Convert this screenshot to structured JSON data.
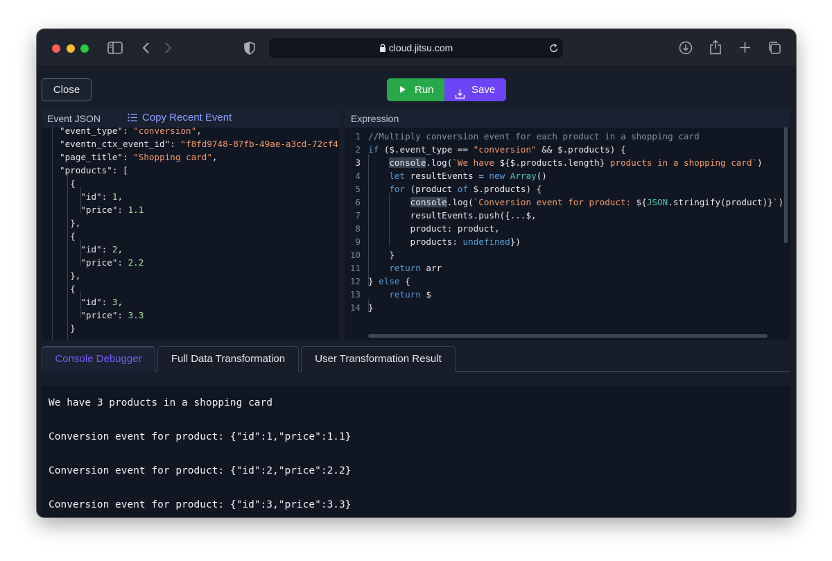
{
  "browser": {
    "url": "cloud.jitsu.com"
  },
  "actions": {
    "close_label": "Close",
    "run_label": "Run",
    "save_label": "Save"
  },
  "event_panel": {
    "title": "Event JSON",
    "copy_label": "Copy Recent Event",
    "lines": [
      {
        "parts": [
          {
            "t": "\"event_type\"",
            "c": "jk"
          },
          {
            "t": ": ",
            "c": "jk"
          },
          {
            "t": "\"conversion\"",
            "c": "js"
          },
          {
            "t": ",",
            "c": "jk"
          }
        ]
      },
      {
        "parts": [
          {
            "t": "\"eventn_ctx_event_id\"",
            "c": "jk"
          },
          {
            "t": ": ",
            "c": "jk"
          },
          {
            "t": "\"f8fd9748-87fb-49ae-a3cd-72cf4",
            "c": "js"
          }
        ]
      },
      {
        "parts": [
          {
            "t": "\"page_title\"",
            "c": "jk"
          },
          {
            "t": ": ",
            "c": "jk"
          },
          {
            "t": "\"Shopping card\"",
            "c": "js"
          },
          {
            "t": ",",
            "c": "jk"
          }
        ]
      },
      {
        "parts": [
          {
            "t": "\"products\"",
            "c": "jk"
          },
          {
            "t": ": [",
            "c": "jk"
          }
        ]
      },
      {
        "parts": [
          {
            "t": "  {",
            "c": "jk"
          }
        ]
      },
      {
        "parts": [
          {
            "t": "    \"id\"",
            "c": "jk"
          },
          {
            "t": ": ",
            "c": "jk"
          },
          {
            "t": "1",
            "c": "jn"
          },
          {
            "t": ",",
            "c": "jk"
          }
        ]
      },
      {
        "parts": [
          {
            "t": "    \"price\"",
            "c": "jk"
          },
          {
            "t": ": ",
            "c": "jk"
          },
          {
            "t": "1.1",
            "c": "jn"
          }
        ]
      },
      {
        "parts": [
          {
            "t": "  },",
            "c": "jk"
          }
        ]
      },
      {
        "parts": [
          {
            "t": "  {",
            "c": "jk"
          }
        ]
      },
      {
        "parts": [
          {
            "t": "    \"id\"",
            "c": "jk"
          },
          {
            "t": ": ",
            "c": "jk"
          },
          {
            "t": "2",
            "c": "jn"
          },
          {
            "t": ",",
            "c": "jk"
          }
        ]
      },
      {
        "parts": [
          {
            "t": "    \"price\"",
            "c": "jk"
          },
          {
            "t": ": ",
            "c": "jk"
          },
          {
            "t": "2.2",
            "c": "jn"
          }
        ]
      },
      {
        "parts": [
          {
            "t": "  },",
            "c": "jk"
          }
        ]
      },
      {
        "parts": [
          {
            "t": "  {",
            "c": "jk"
          }
        ]
      },
      {
        "parts": [
          {
            "t": "    \"id\"",
            "c": "jk"
          },
          {
            "t": ": ",
            "c": "jk"
          },
          {
            "t": "3",
            "c": "jn"
          },
          {
            "t": ",",
            "c": "jk"
          }
        ]
      },
      {
        "parts": [
          {
            "t": "    \"price\"",
            "c": "jk"
          },
          {
            "t": ": ",
            "c": "jk"
          },
          {
            "t": "3.3",
            "c": "jn"
          }
        ]
      },
      {
        "parts": [
          {
            "t": "  }",
            "c": "jk"
          }
        ]
      }
    ]
  },
  "expression_panel": {
    "title": "Expression",
    "active_line": 3,
    "lines": [
      {
        "n": "1",
        "parts": [
          {
            "t": "//Multiply conversion event for each product in a shopping card",
            "c": "cm"
          }
        ]
      },
      {
        "n": "2",
        "parts": [
          {
            "t": "if",
            "c": "kw"
          },
          {
            "t": " ($.event_type == ",
            "c": ""
          },
          {
            "t": "\"conversion\"",
            "c": "str"
          },
          {
            "t": " && $.products) {",
            "c": ""
          }
        ]
      },
      {
        "n": "3",
        "parts": [
          {
            "t": "    ",
            "c": ""
          },
          {
            "t": "console",
            "c": "hl"
          },
          {
            "t": ".log(",
            "c": ""
          },
          {
            "t": "`We have ",
            "c": "str"
          },
          {
            "t": "${$.products.length}",
            "c": ""
          },
          {
            "t": " products in a shopping card`",
            "c": "str"
          },
          {
            "t": ")",
            "c": ""
          }
        ]
      },
      {
        "n": "4",
        "parts": [
          {
            "t": "    ",
            "c": ""
          },
          {
            "t": "let",
            "c": "kw"
          },
          {
            "t": " resultEvents = ",
            "c": ""
          },
          {
            "t": "new",
            "c": "kw"
          },
          {
            "t": " ",
            "c": ""
          },
          {
            "t": "Array",
            "c": "ty"
          },
          {
            "t": "()",
            "c": ""
          }
        ]
      },
      {
        "n": "5",
        "parts": [
          {
            "t": "    ",
            "c": ""
          },
          {
            "t": "for",
            "c": "kw"
          },
          {
            "t": " (product ",
            "c": ""
          },
          {
            "t": "of",
            "c": "kw"
          },
          {
            "t": " $.products) {",
            "c": ""
          }
        ]
      },
      {
        "n": "6",
        "parts": [
          {
            "t": "        ",
            "c": ""
          },
          {
            "t": "console",
            "c": "hl"
          },
          {
            "t": ".log(",
            "c": ""
          },
          {
            "t": "`Conversion event for product: ",
            "c": "str"
          },
          {
            "t": "${",
            "c": ""
          },
          {
            "t": "JSON",
            "c": "ty"
          },
          {
            "t": ".stringify(product)}",
            "c": ""
          },
          {
            "t": "`",
            "c": "str"
          },
          {
            "t": ")",
            "c": ""
          }
        ]
      },
      {
        "n": "7",
        "parts": [
          {
            "t": "        resultEvents.push({...$,",
            "c": ""
          }
        ]
      },
      {
        "n": "8",
        "parts": [
          {
            "t": "        product: product,",
            "c": ""
          }
        ]
      },
      {
        "n": "9",
        "parts": [
          {
            "t": "        products: ",
            "c": ""
          },
          {
            "t": "undefined",
            "c": "kw"
          },
          {
            "t": "})",
            "c": ""
          }
        ]
      },
      {
        "n": "10",
        "parts": [
          {
            "t": "    }",
            "c": ""
          }
        ]
      },
      {
        "n": "11",
        "parts": [
          {
            "t": "    ",
            "c": ""
          },
          {
            "t": "return",
            "c": "kw"
          },
          {
            "t": " arr",
            "c": ""
          }
        ]
      },
      {
        "n": "12",
        "parts": [
          {
            "t": "} ",
            "c": ""
          },
          {
            "t": "else",
            "c": "kw"
          },
          {
            "t": " {",
            "c": ""
          }
        ]
      },
      {
        "n": "13",
        "parts": [
          {
            "t": "    ",
            "c": ""
          },
          {
            "t": "return",
            "c": "kw"
          },
          {
            "t": " $",
            "c": ""
          }
        ]
      },
      {
        "n": "14",
        "parts": [
          {
            "t": "}",
            "c": ""
          }
        ]
      }
    ]
  },
  "tabs": [
    {
      "label": "Console Debugger",
      "active": true
    },
    {
      "label": "Full Data Transformation",
      "active": false
    },
    {
      "label": "User Transformation Result",
      "active": false
    }
  ],
  "console": {
    "rows": [
      "We have 3 products in a shopping card",
      "Conversion event for product: {\"id\":1,\"price\":1.1}",
      "Conversion event for product: {\"id\":2,\"price\":2.2}",
      "Conversion event for product: {\"id\":3,\"price\":3.3}"
    ]
  },
  "colors": {
    "run": "#27a94a",
    "save": "#6c44f5",
    "active_tab": "#7b5cf6",
    "link": "#8aa2ff"
  }
}
